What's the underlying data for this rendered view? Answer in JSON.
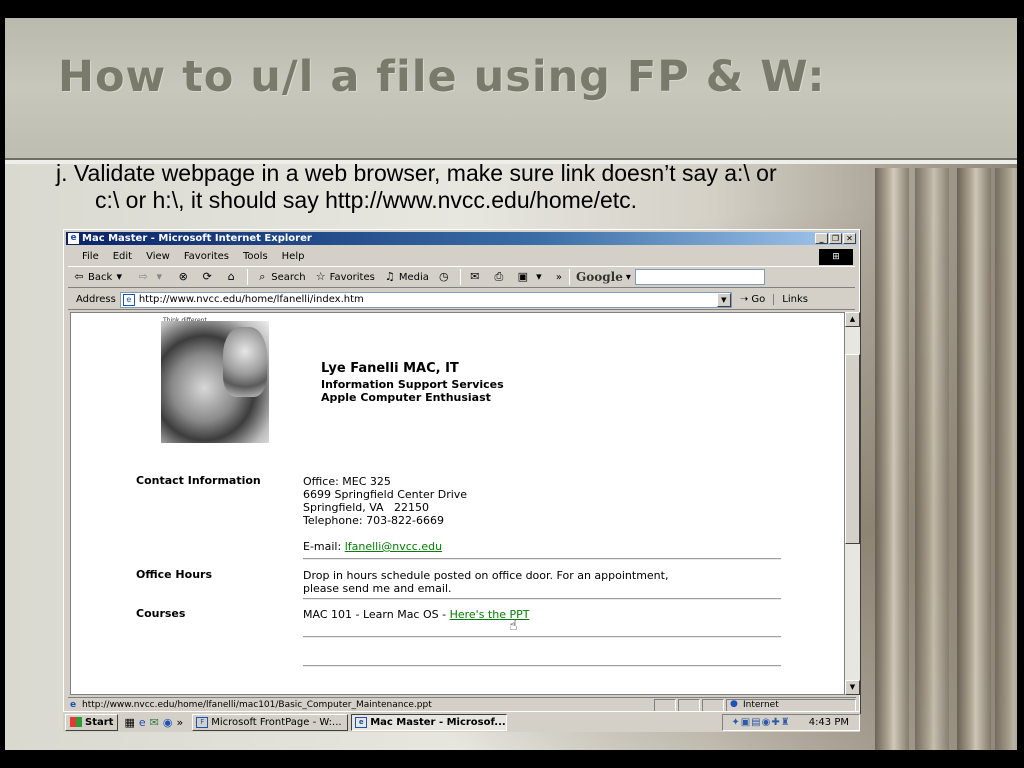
{
  "slide": {
    "title": "How to u/l a file using FP & W:",
    "text_line1": "j. Validate webpage in a web browser, make sure link doesn’t say a:\\ or",
    "text_line2": "c:\\ or h:\\, it should say http://www.nvcc.edu/home/etc."
  },
  "browser": {
    "window_title": "Mac Master - Microsoft Internet Explorer",
    "menu": [
      "File",
      "Edit",
      "View",
      "Favorites",
      "Tools",
      "Help"
    ],
    "toolbar": {
      "back": "Back",
      "search": "Search",
      "favorites": "Favorites",
      "media": "Media",
      "overflow": "»",
      "google_logo": "Google"
    },
    "address": {
      "label": "Address",
      "url": "http://www.nvcc.edu/home/lfanelli/index.htm",
      "go": "Go",
      "links": "Links"
    },
    "status": {
      "text": "http://www.nvcc.edu/home/lfanelli/mac101/Basic_Computer_Maintenance.ppt",
      "zone": "Internet"
    }
  },
  "page": {
    "think_different": "Think different.",
    "name": "Lye Fanelli MAC, IT",
    "dept": "Information Support Services",
    "tagline": "Apple Computer Enthusiast",
    "contact_label": "Contact Information",
    "office": "Office: MEC 325",
    "street": "6699 Springfield Center Drive",
    "city": "Springfield, VA   22150",
    "phone": "Telephone: 703-822-6669",
    "email_label": "E-mail:",
    "email": "lfanelli@nvcc.edu",
    "hours_label": "Office Hours",
    "hours_line1": "Drop in hours schedule posted on office door. For an appointment,",
    "hours_line2": "please send me and email.",
    "courses_label": "Courses",
    "course_text": "MAC 101 - Learn Mac OS - ",
    "course_link": "Here's the PPT"
  },
  "taskbar": {
    "start": "Start",
    "task1": "Microsoft FrontPage - W:...",
    "task2": "Mac Master - Microsof...",
    "clock": "4:43 PM"
  },
  "colors": {
    "title_gray": "#7a7a6c",
    "link_green": "#008000",
    "titlebar_blue": "#0a246a"
  }
}
